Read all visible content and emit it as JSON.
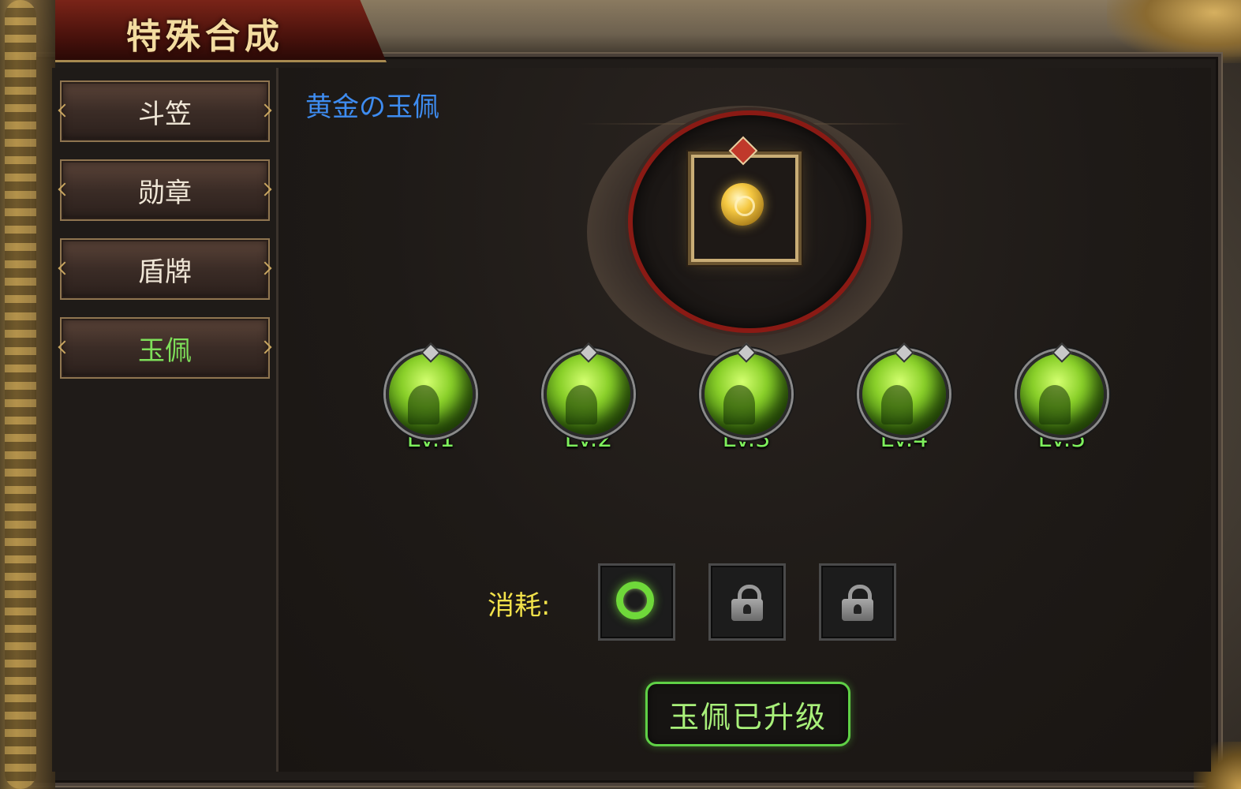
{
  "window": {
    "title": "特殊合成"
  },
  "sidebar": {
    "items": [
      {
        "label": "斗笠",
        "active": false
      },
      {
        "label": "勋章",
        "active": false
      },
      {
        "label": "盾牌",
        "active": false
      },
      {
        "label": "玉佩",
        "active": true
      }
    ]
  },
  "item": {
    "name": "黄金の玉佩",
    "icon": "gold-medal-icon"
  },
  "levels": [
    {
      "label": "Lv.1"
    },
    {
      "label": "Lv.2"
    },
    {
      "label": "Lv.3"
    },
    {
      "label": "Lv.4"
    },
    {
      "label": "Lv.5"
    }
  ],
  "cost": {
    "label": "消耗:",
    "slots": [
      {
        "icon": "green-ring-icon",
        "locked": false
      },
      {
        "icon": "lock-icon",
        "locked": true
      },
      {
        "icon": "lock-icon",
        "locked": true
      }
    ]
  },
  "action": {
    "label": "玉佩已升级"
  },
  "colors": {
    "active_tab": "#7ee05a",
    "item_name": "#3e8cf0",
    "level_text": "#7ef05c",
    "cost_label": "#f2e24a",
    "action_border": "#5fd046"
  }
}
